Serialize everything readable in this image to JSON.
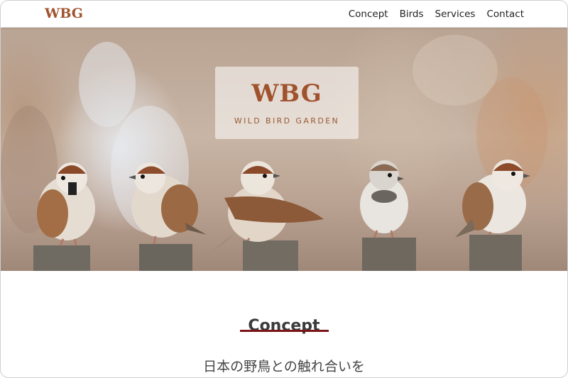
{
  "header": {
    "logo_text": "WBG",
    "nav": [
      {
        "label": "Concept"
      },
      {
        "label": "Birds"
      },
      {
        "label": "Services"
      },
      {
        "label": "Contact"
      }
    ]
  },
  "hero": {
    "brand_mark": "WBG",
    "brand_name": "WILD BIRD GARDEN",
    "image_subject": "five sparrows perched on wooden posts"
  },
  "concept": {
    "title": "Concept",
    "subtitle": "日本の野鳥との触れ合いを"
  },
  "colors": {
    "brand": "#a0522d",
    "underline": "#7a1418",
    "text": "#3b3b3b"
  }
}
